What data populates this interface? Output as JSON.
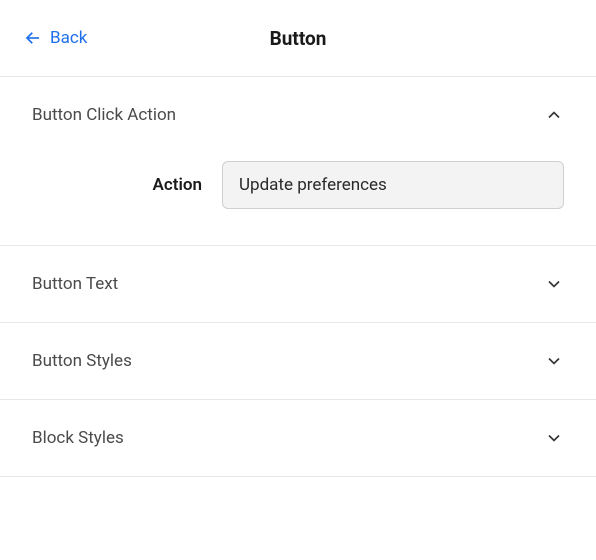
{
  "header": {
    "back_label": "Back",
    "title": "Button"
  },
  "sections": {
    "click_action": {
      "title": "Button Click Action",
      "expanded": true,
      "field_label": "Action",
      "field_value": "Update preferences"
    },
    "button_text": {
      "title": "Button Text",
      "expanded": false
    },
    "button_styles": {
      "title": "Button Styles",
      "expanded": false
    },
    "block_styles": {
      "title": "Block Styles",
      "expanded": false
    }
  }
}
